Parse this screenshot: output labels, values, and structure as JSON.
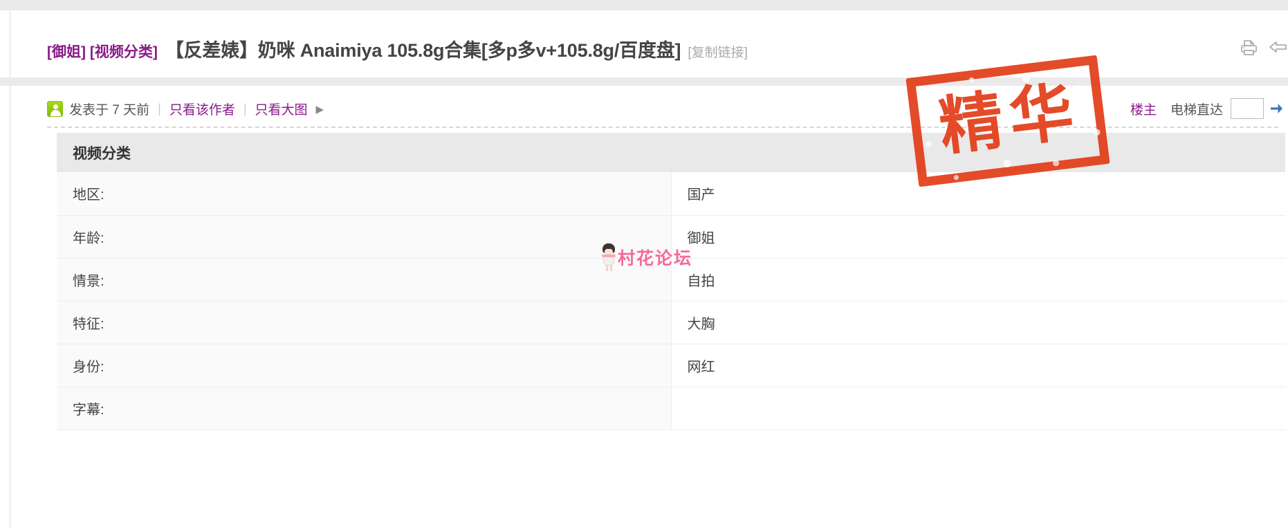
{
  "thread": {
    "tag_prefix": "[御姐] [视频分类]",
    "title": "【反差婊】奶咪 Anaimiya 105.8g合集[多p多v+105.8g/百度盘]",
    "title_suffix": "[复制链接]",
    "print_icon": "printer-icon",
    "share_icon": "share-arrow-icon"
  },
  "meta": {
    "avatar_icon": "user-avatar-icon",
    "posted": "发表于 7 天前",
    "divider": "|",
    "only_author": "只看该作者",
    "only_images": "只看大图",
    "expand_arrow": "▶",
    "floor_owner": "楼主",
    "elevator_label": "电梯直达",
    "elevator_value": "",
    "elevator_placeholder": "",
    "go_icon": "go-arrow-icon"
  },
  "stamp": {
    "label": "精华",
    "color": "#e23c17"
  },
  "watermark": {
    "text": "村花论坛",
    "color": "#f56a9a",
    "icon": "girl-mascot-icon"
  },
  "table": {
    "header": "视频分类",
    "rows": [
      {
        "key": "地区:",
        "value": "国产"
      },
      {
        "key": "年龄:",
        "value": "御姐"
      },
      {
        "key": "情景:",
        "value": "自拍"
      },
      {
        "key": "特征:",
        "value": "大胸"
      },
      {
        "key": "身份:",
        "value": "网红"
      },
      {
        "key": "字幕:",
        "value": ""
      }
    ]
  },
  "colors": {
    "link_purple": "#8a1a8a",
    "title_dark": "#444444",
    "band_gray": "#eaeaea",
    "header_gray": "#e9e9e9"
  }
}
